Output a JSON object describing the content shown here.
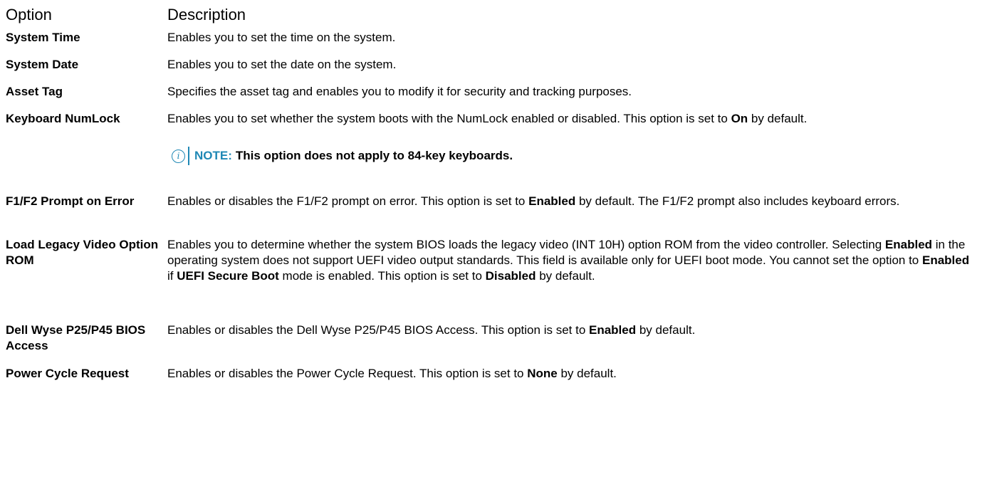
{
  "header": {
    "option": "Option",
    "description": "Description"
  },
  "rows": [
    {
      "option": "System Time",
      "description": [
        {
          "text": "Enables you to set the time on the system.",
          "bold": false
        }
      ]
    },
    {
      "option": "System Date",
      "description": [
        {
          "text": "Enables you to set the date on the system.",
          "bold": false
        }
      ]
    },
    {
      "option": "Asset Tag",
      "description": [
        {
          "text": "Specifies the asset tag and enables you to modify it for security and tracking purposes.",
          "bold": false
        }
      ]
    },
    {
      "option": "Keyboard NumLock",
      "description": [
        {
          "text": "Enables you to set whether the system boots with the NumLock enabled or disabled. This option is set to ",
          "bold": false
        },
        {
          "text": "On",
          "bold": true
        },
        {
          "text": " by default.",
          "bold": false
        }
      ]
    },
    {
      "option": "F1/F2 Prompt on Error",
      "description": [
        {
          "text": "Enables or disables the F1/F2 prompt on error. This option is set to ",
          "bold": false
        },
        {
          "text": "Enabled",
          "bold": true
        },
        {
          "text": " by default. The F1/F2 prompt also includes keyboard errors.",
          "bold": false
        }
      ]
    },
    {
      "option": "Load Legacy Video Option ROM",
      "description": [
        {
          "text": "Enables you to determine whether the system BIOS loads the legacy video (INT 10H) option ROM from the video controller. Selecting ",
          "bold": false
        },
        {
          "text": "Enabled",
          "bold": true
        },
        {
          "text": " in the operating system does not support UEFI video output standards. This field is available only for UEFI boot mode. You cannot set the option to ",
          "bold": false
        },
        {
          "text": "Enabled",
          "bold": true
        },
        {
          "text": " if ",
          "bold": false
        },
        {
          "text": "UEFI Secure Boot",
          "bold": true
        },
        {
          "text": " mode is enabled. This option is set to ",
          "bold": false
        },
        {
          "text": "Disabled",
          "bold": true
        },
        {
          "text": " by default.",
          "bold": false
        }
      ]
    },
    {
      "option": "Dell Wyse P25/P45 BIOS Access",
      "description": [
        {
          "text": "Enables or disables the Dell Wyse P25/P45 BIOS Access. This option is set to ",
          "bold": false
        },
        {
          "text": "Enabled",
          "bold": true
        },
        {
          "text": " by default.",
          "bold": false
        }
      ]
    },
    {
      "option": "Power Cycle Request",
      "description": [
        {
          "text": "Enables or disables the Power Cycle Request. This option is set to ",
          "bold": false
        },
        {
          "text": "None",
          "bold": true
        },
        {
          "text": " by default.",
          "bold": false
        }
      ]
    }
  ],
  "note": {
    "icon": "info-icon",
    "icon_glyph": "i",
    "label": "NOTE:",
    "text": "This option does not apply to 84-key keyboards.",
    "color": "#1f88b5"
  }
}
